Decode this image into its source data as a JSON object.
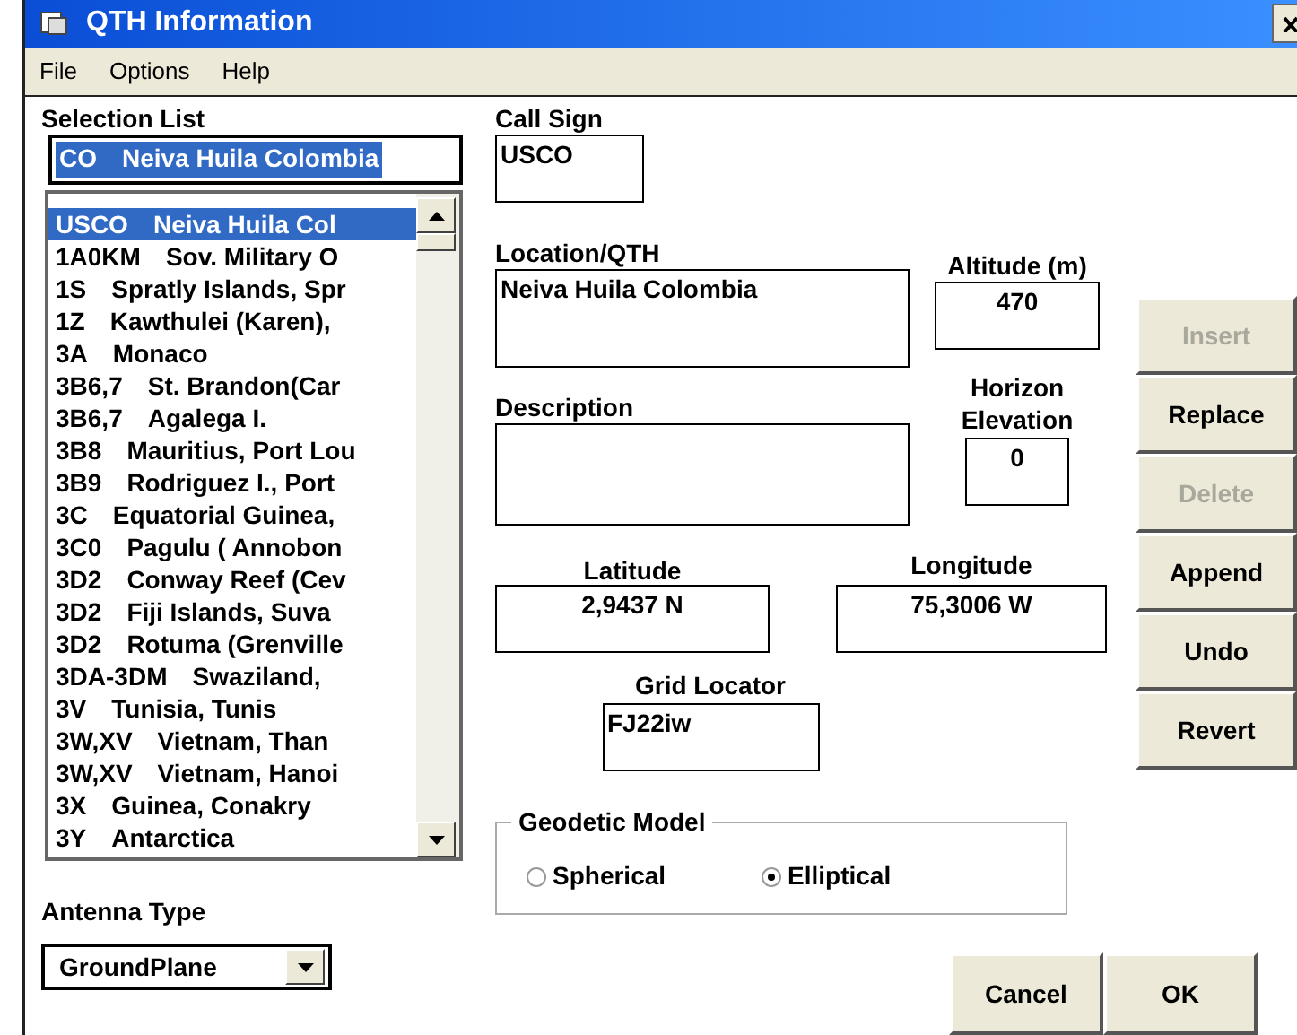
{
  "window": {
    "title": "QTH Information"
  },
  "menu": [
    {
      "label": "File"
    },
    {
      "label": "Options"
    },
    {
      "label": "Help"
    }
  ],
  "selection_list": {
    "label": "Selection List",
    "field": {
      "code": "CO",
      "name": "Neiva Huila Colombia"
    },
    "items": [
      {
        "code": "USCO",
        "name": "Neiva Huila Col",
        "selected": true
      },
      {
        "code": "1A0KM",
        "name": "Sov. Military O",
        "selected": false
      },
      {
        "code": "1S",
        "name": "Spratly Islands, Spr",
        "selected": false
      },
      {
        "code": "1Z",
        "name": "Kawthulei (Karen),",
        "selected": false
      },
      {
        "code": "3A",
        "name": "Monaco",
        "selected": false
      },
      {
        "code": "3B6,7",
        "name": "St. Brandon(Car",
        "selected": false
      },
      {
        "code": "3B6,7",
        "name": "Agalega I.",
        "selected": false
      },
      {
        "code": "3B8",
        "name": "Mauritius, Port Lou",
        "selected": false
      },
      {
        "code": "3B9",
        "name": "Rodriguez I., Port",
        "selected": false
      },
      {
        "code": "3C",
        "name": "Equatorial Guinea,",
        "selected": false
      },
      {
        "code": "3C0",
        "name": "Pagulu ( Annobon",
        "selected": false
      },
      {
        "code": "3D2",
        "name": "Conway Reef (Cev",
        "selected": false
      },
      {
        "code": "3D2",
        "name": "Fiji Islands, Suva",
        "selected": false
      },
      {
        "code": "3D2",
        "name": "Rotuma (Grenville",
        "selected": false
      },
      {
        "code": "3DA-3DM",
        "name": "Swaziland,",
        "selected": false
      },
      {
        "code": "3V",
        "name": "Tunisia, Tunis",
        "selected": false
      },
      {
        "code": "3W,XV",
        "name": "Vietnam, Than",
        "selected": false
      },
      {
        "code": "3W,XV",
        "name": "Vietnam, Hanoi",
        "selected": false
      },
      {
        "code": "3X",
        "name": "Guinea, Conakry",
        "selected": false
      },
      {
        "code": "3Y",
        "name": "Antarctica",
        "selected": false
      }
    ]
  },
  "antenna_type": {
    "label": "Antenna Type",
    "value": "GroundPlane"
  },
  "call_sign": {
    "label": "Call Sign",
    "value": "USCO"
  },
  "location": {
    "label": "Location/QTH",
    "value": "Neiva Huila Colombia"
  },
  "altitude": {
    "label": "Altitude (m)",
    "value": "470"
  },
  "description": {
    "label": "Description"
  },
  "horizon_elevation": {
    "label_line_1": "Horizon",
    "label_line_2": "Elevation",
    "value": "0"
  },
  "latitude": {
    "label": "Latitude",
    "value": "2,9437 N"
  },
  "longitude": {
    "label": "Longitude",
    "value": "75,3006 W"
  },
  "grid_locator": {
    "label": "Grid Locator",
    "value": "FJ22iw"
  },
  "geodetic_model": {
    "label": "Geodetic Model",
    "options": [
      {
        "label": "Spherical",
        "selected": false
      },
      {
        "label": "Elliptical",
        "selected": true
      }
    ]
  },
  "side_buttons": [
    {
      "label": "Insert",
      "disabled": true
    },
    {
      "label": "Replace",
      "disabled": false
    },
    {
      "label": "Delete",
      "disabled": true
    },
    {
      "label": "Append",
      "disabled": false
    },
    {
      "label": "Undo",
      "disabled": false
    },
    {
      "label": "Revert",
      "disabled": false
    }
  ],
  "bottom_buttons": [
    {
      "label": "Cancel"
    },
    {
      "label": "OK"
    }
  ]
}
